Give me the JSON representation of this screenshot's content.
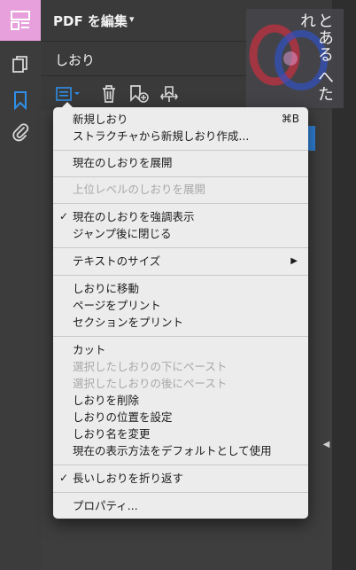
{
  "header": {
    "title": "PDF を編集",
    "caret": "▾"
  },
  "bookmarks_pane": {
    "title": "しおり"
  },
  "rail": {
    "items": [
      {
        "icon": "edit-pdf-icon"
      },
      {
        "icon": "pages-icon"
      },
      {
        "icon": "bookmark-icon"
      },
      {
        "icon": "attachment-icon"
      }
    ],
    "active_color": "#e8a0dc",
    "accent_color": "#2f8fe8"
  },
  "watermark": {
    "text": "とある へたれ"
  },
  "menu": {
    "items": [
      {
        "label": "新規しおり",
        "shortcut": "⌘B"
      },
      {
        "label": "ストラクチャから新規しおり作成..."
      },
      {
        "label": "現在のしおりを展開"
      },
      {
        "label": "上位レベルのしおりを展開",
        "disabled": true
      },
      {
        "label": "現在のしおりを強調表示",
        "check": "✓"
      },
      {
        "label": "ジャンプ後に閉じる"
      },
      {
        "label": "テキストのサイズ",
        "arrow": "▶"
      },
      {
        "label": "しおりに移動"
      },
      {
        "label": "ページをプリント"
      },
      {
        "label": "セクションをプリント"
      },
      {
        "label": "カット"
      },
      {
        "label": "選択したしおりの下にペースト",
        "disabled": true
      },
      {
        "label": "選択したしおりの後にペースト",
        "disabled": true
      },
      {
        "label": "しおりを削除"
      },
      {
        "label": "しおりの位置を設定"
      },
      {
        "label": "しおり名を変更"
      },
      {
        "label": "現在の表示方法をデフォルトとして使用"
      },
      {
        "label": "長いしおりを折り返す",
        "check": "✓"
      },
      {
        "label": "プロパティ..."
      }
    ]
  }
}
